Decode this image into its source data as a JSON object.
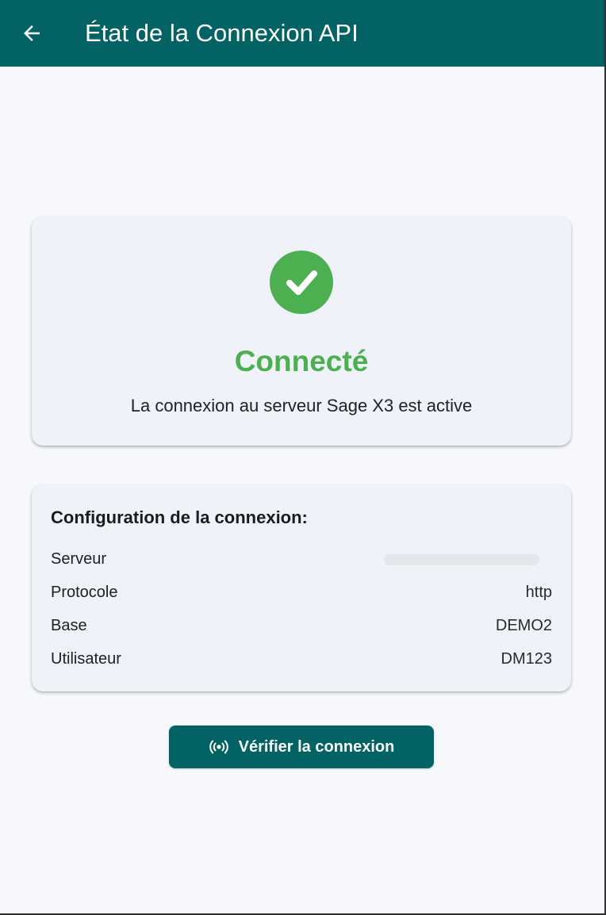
{
  "app_bar": {
    "title": "État de la Connexion API",
    "back_icon": "arrow-back-icon",
    "background": "#026264"
  },
  "status": {
    "icon": "check-circle-icon",
    "title": "Connecté",
    "message": "La connexion au serveur Sage X3 est active",
    "color": "#4caf50"
  },
  "config": {
    "title": "Configuration de la connexion:",
    "rows": [
      {
        "label": "Serveur",
        "value": "",
        "redacted": true
      },
      {
        "label": "Protocole",
        "value": "http"
      },
      {
        "label": "Base",
        "value": "DEMO2"
      },
      {
        "label": "Utilisateur",
        "value": "DM123"
      }
    ]
  },
  "verify_button": {
    "label": "Vérifier la connexion",
    "icon": "broadcast-signal-icon",
    "background": "#026264"
  }
}
